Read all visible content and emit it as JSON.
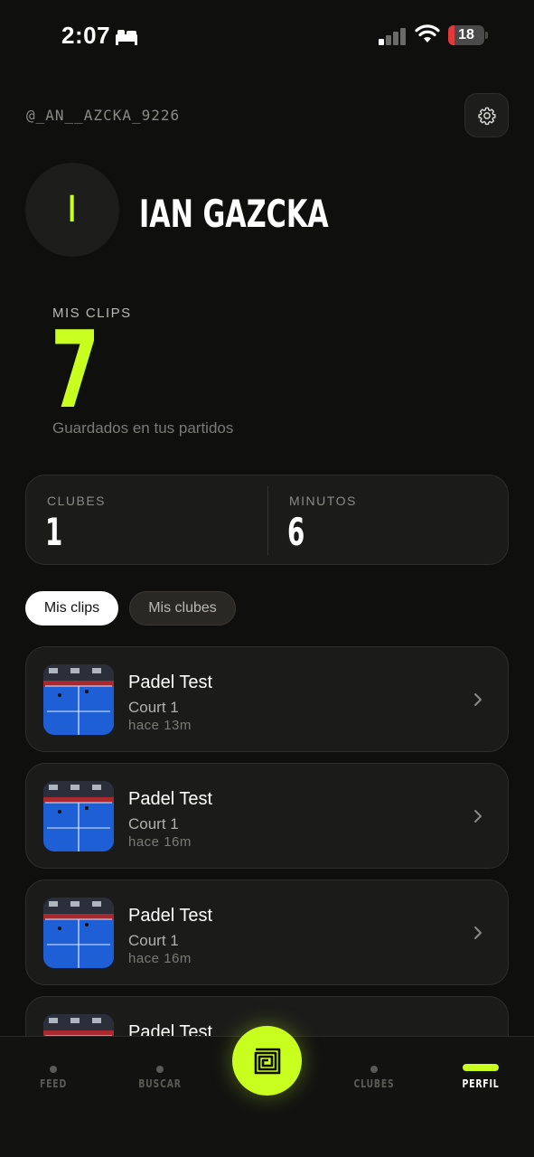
{
  "status_bar": {
    "time": "2:07",
    "battery_level": "18",
    "battery_fraction": 0.18,
    "icons": [
      "bed-icon",
      "signal-icon",
      "wifi-icon",
      "battery-icon"
    ]
  },
  "header": {
    "handle": "@_AN__AZCKA_9226",
    "settings_icon": "gear-icon"
  },
  "profile": {
    "avatar_initial": "I",
    "name": "IAN GAZCKA",
    "accent_color": "#c8ff1e"
  },
  "clips_summary": {
    "label": "MIS CLIPS",
    "count": "7",
    "subtitle": "Guardados en tus partidos"
  },
  "stats": [
    {
      "label": "CLUBES",
      "value": "1"
    },
    {
      "label": "MINUTOS",
      "value": "6"
    }
  ],
  "tabs": [
    {
      "label": "Mis clips",
      "active": true
    },
    {
      "label": "Mis clubes",
      "active": false
    }
  ],
  "clips": [
    {
      "title": "Padel Test",
      "court": "Court 1",
      "time": "hace 13m"
    },
    {
      "title": "Padel Test",
      "court": "Court 1",
      "time": "hace 16m"
    },
    {
      "title": "Padel Test",
      "court": "Court 1",
      "time": "hace 16m"
    },
    {
      "title": "Padel Test",
      "court": "",
      "time": ""
    }
  ],
  "bottom_nav": {
    "items": [
      {
        "label": "FEED",
        "active": false
      },
      {
        "label": "BUSCAR",
        "active": false
      },
      {
        "label": "CLUBES",
        "active": false
      },
      {
        "label": "PERFIL",
        "active": true
      }
    ],
    "center_button_icon": "spiral-icon"
  }
}
